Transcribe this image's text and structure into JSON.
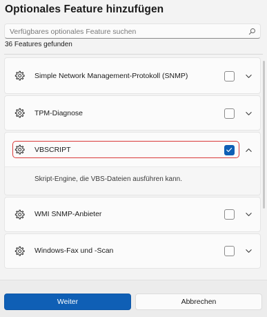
{
  "dialog": {
    "title": "Optionales Feature hinzufügen",
    "search_placeholder": "Verfügbares optionales Feature suchen",
    "search_value": "",
    "result_count": "36 Features gefunden"
  },
  "features": [
    {
      "label": "Simple Network Management-Protokoll (SNMP)",
      "checked": false,
      "expanded": false,
      "icon": "gear-icon"
    },
    {
      "label": "TPM-Diagnose",
      "checked": false,
      "expanded": false,
      "icon": "gear-icon"
    },
    {
      "label": "VBSCRIPT",
      "checked": true,
      "expanded": true,
      "icon": "gear-icon",
      "description": "Skript-Engine, die VBS-Dateien ausführen kann."
    },
    {
      "label": "WMI SNMP-Anbieter",
      "checked": false,
      "expanded": false,
      "icon": "gear-icon"
    },
    {
      "label": "Windows-Fax und -Scan",
      "checked": false,
      "expanded": false,
      "icon": "gear-icon"
    }
  ],
  "footer": {
    "primary_label": "Weiter",
    "secondary_label": "Abbrechen"
  },
  "colors": {
    "accent": "#0f5fb5",
    "highlight": "#d93a3a"
  }
}
